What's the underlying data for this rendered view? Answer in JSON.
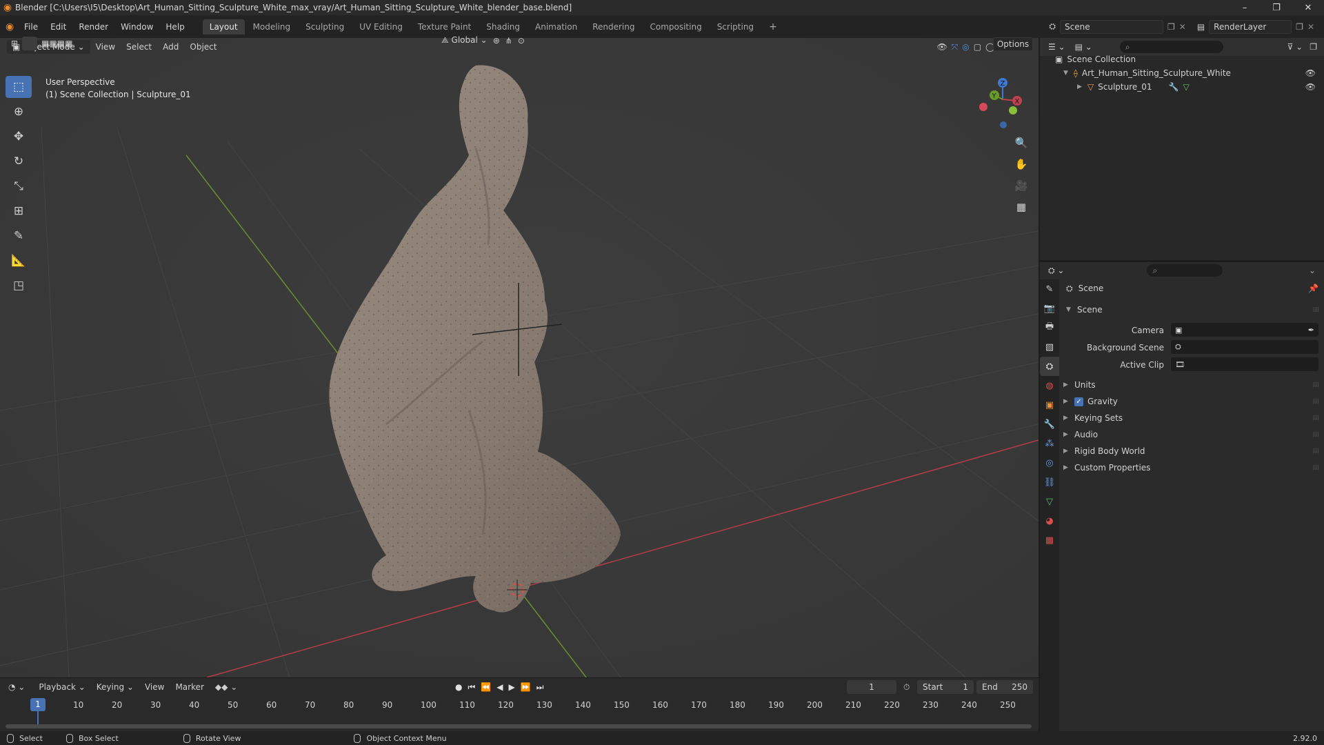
{
  "window": {
    "title": "Blender [C:\\Users\\I5\\Desktop\\Art_Human_Sitting_Sculpture_White_max_vray/Art_Human_Sitting_Sculpture_White_blender_base.blend]",
    "controls": [
      "–",
      "❐",
      "✕"
    ]
  },
  "menu": [
    "File",
    "Edit",
    "Render",
    "Window",
    "Help"
  ],
  "workspaces": [
    {
      "label": "Layout",
      "active": true
    },
    {
      "label": "Modeling"
    },
    {
      "label": "Sculpting"
    },
    {
      "label": "UV Editing"
    },
    {
      "label": "Texture Paint"
    },
    {
      "label": "Shading"
    },
    {
      "label": "Animation"
    },
    {
      "label": "Rendering"
    },
    {
      "label": "Compositing"
    },
    {
      "label": "Scripting"
    }
  ],
  "add_workspace": "+",
  "scene_field": "Scene",
  "renderlayer_field": "RenderLayer",
  "viewport": {
    "mode": "Object Mode",
    "menus": [
      "View",
      "Select",
      "Add",
      "Object"
    ],
    "orientation": "Global",
    "options_label": "Options",
    "info_line1": "User Perspective",
    "info_line2": "(1) Scene Collection | Sculpture_01",
    "gizmo_axes": {
      "x": "X",
      "y": "Y",
      "z": "Z"
    }
  },
  "timeline": {
    "menus": [
      "Playback",
      "Keying",
      "View",
      "Marker"
    ],
    "current_frame": "1",
    "start_label": "Start",
    "start_value": "1",
    "end_label": "End",
    "end_value": "250",
    "ruler_current": "1",
    "ruler": [
      "10",
      "20",
      "30",
      "40",
      "50",
      "60",
      "70",
      "80",
      "90",
      "100",
      "110",
      "120",
      "130",
      "140",
      "150",
      "160",
      "170",
      "180",
      "190",
      "200",
      "210",
      "220",
      "230",
      "240",
      "250"
    ]
  },
  "statusbar": {
    "select": "Select",
    "box_select": "Box Select",
    "rotate_view": "Rotate View",
    "context_menu": "Object Context Menu",
    "version": "2.92.0"
  },
  "outliner": {
    "root": "Scene Collection",
    "collection": "Art_Human_Sitting_Sculpture_White",
    "object": "Sculpture_01"
  },
  "properties": {
    "header": "Scene",
    "panel_title": "Scene",
    "camera_label": "Camera",
    "background_label": "Background Scene",
    "clip_label": "Active Clip",
    "panels": [
      "Units",
      "Gravity",
      "Keying Sets",
      "Audio",
      "Rigid Body World",
      "Custom Properties"
    ]
  },
  "colors": {
    "accent": "#4772b3",
    "x_axis": "#c0404e",
    "y_axis": "#6a9c2a",
    "z_axis": "#3f7ad0",
    "sculpture": "#8c7f74"
  }
}
